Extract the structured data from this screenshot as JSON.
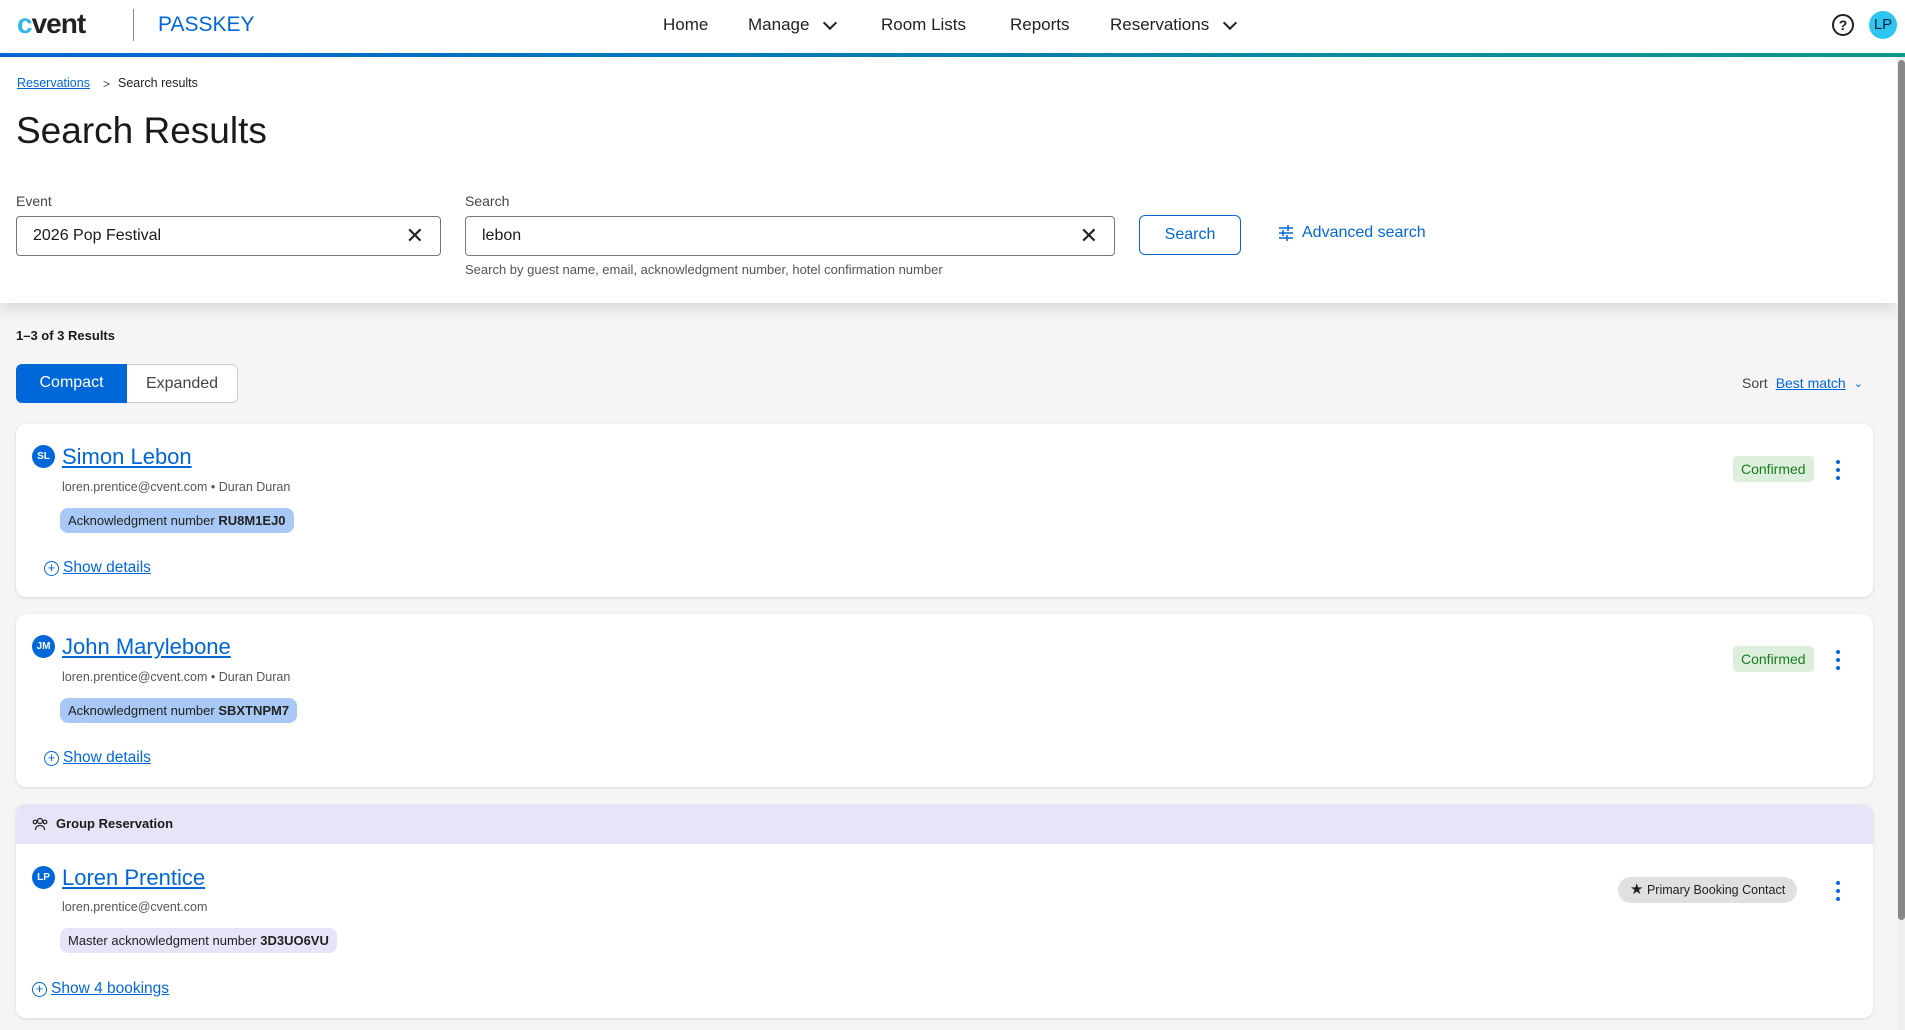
{
  "header": {
    "logo": "cvent",
    "product": "PASSKEY",
    "nav": [
      {
        "label": "Home"
      },
      {
        "label": "Manage",
        "dropdown": true
      },
      {
        "label": "Room Lists"
      },
      {
        "label": "Reports"
      },
      {
        "label": "Reservations",
        "dropdown": true
      }
    ],
    "help": "?",
    "user_initials": "LP"
  },
  "breadcrumb": {
    "parent": "Reservations",
    "separator": ">",
    "current": "Search results"
  },
  "page_title": "Search Results",
  "filters": {
    "event_label": "Event",
    "event_value": "2026 Pop Festival",
    "search_label": "Search",
    "search_value": "lebon",
    "search_hint": "Search by guest name, email, acknowledgment number, hotel confirmation number",
    "search_button": "Search",
    "advanced_search": "Advanced search"
  },
  "results": {
    "count": "1–3 of 3 Results",
    "view_compact": "Compact",
    "view_expanded": "Expanded",
    "sort_label": "Sort",
    "sort_value": "Best match"
  },
  "cards": [
    {
      "initials": "SL",
      "name": "Simon Lebon",
      "email": "loren.prentice@cvent.com",
      "group": "Duran Duran",
      "ack_label": "Acknowledgment number",
      "ack": "RU8M1EJ0",
      "status": "Confirmed",
      "show": "Show details"
    },
    {
      "initials": "JM",
      "name": "John Marylebone",
      "email": "loren.prentice@cvent.com",
      "group": "Duran Duran",
      "ack_label": "Acknowledgment number",
      "ack": "SBXTNPM7",
      "status": "Confirmed",
      "show": "Show details"
    }
  ],
  "group_card": {
    "header": "Group Reservation",
    "initials": "LP",
    "name": "Loren Prentice",
    "email": "loren.prentice@cvent.com",
    "ack_label": "Master acknowledgment number",
    "ack": "3D3UO6VU",
    "role": "Primary Booking Contact",
    "show": "Show 4 bookings"
  },
  "colors": {
    "brand": "#0067d9",
    "confirmed_bg": "#dcefdc",
    "group_bg": "#e8e4f8",
    "ack_bg": "#a8c8f5"
  }
}
